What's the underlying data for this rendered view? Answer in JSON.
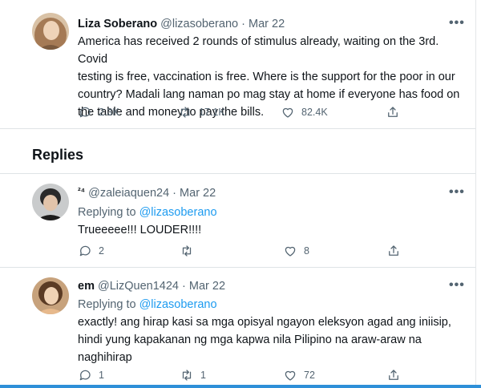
{
  "main_tweet": {
    "display_name": "Liza Soberano",
    "handle": "@lizasoberano",
    "separator": "·",
    "date": "Mar 22",
    "more_label": "•••",
    "text_lines": [
      "America has received 2 rounds of stimulus already, waiting on the 3rd. Covid",
      "testing is free, vaccination is free. Where is the support for the poor in our",
      "country? Madali lang naman po mag stay at home if everyone has food on",
      "the table and money to pay the bills."
    ],
    "replies_count": "2.3K",
    "retweets_count": "17.1K",
    "likes_count": "82.4K"
  },
  "replies_section": {
    "title": "Replies"
  },
  "replies": [
    {
      "display_name": "²⁴",
      "handle": "@zaleiaquen24",
      "separator": "·",
      "date": "Mar 22",
      "more_label": "•••",
      "replying_prefix": "Replying to",
      "replying_handle": "@lizasoberano",
      "text_lines": [
        "Trueeeee!!! LOUDER!!!!"
      ],
      "replies_count": "2",
      "retweets_count": "",
      "likes_count": "8"
    },
    {
      "display_name": "em",
      "handle": "@LizQuen1424",
      "separator": "·",
      "date": "Mar 22",
      "more_label": "•••",
      "replying_prefix": "Replying to",
      "replying_handle": "@lizasoberano",
      "text_lines": [
        "exactly! ang hirap kasi sa mga opisyal ngayon eleksyon agad ang iniisip,",
        "hindi yung kapakanan ng mga kapwa nila Pilipino na araw-araw na",
        "naghihirap"
      ],
      "replies_count": "1",
      "retweets_count": "1",
      "likes_count": "72"
    }
  ],
  "icons": {
    "reply": "reply-bubble-icon",
    "retweet": "retweet-icon",
    "like": "heart-icon",
    "share": "share-upload-icon",
    "more": "more-horizontal-icon"
  },
  "colors": {
    "link": "#1d9bf0",
    "secondary_text": "#536471",
    "primary_text": "#0f1419",
    "divider": "#dfe3e6",
    "bottom_accent": "#2e8fd8"
  }
}
